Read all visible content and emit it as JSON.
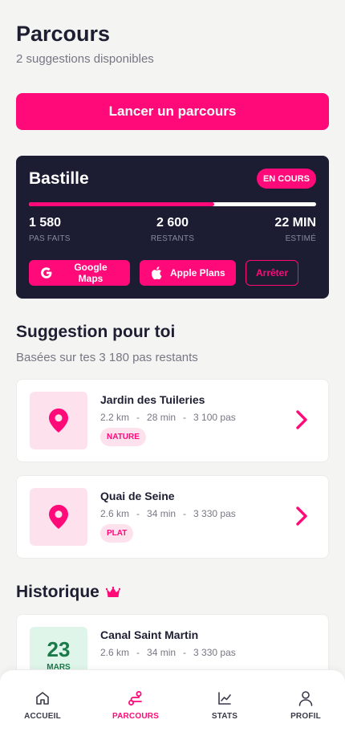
{
  "header": {
    "title": "Parcours",
    "subtitle": "2 suggestions disponibles"
  },
  "launch_button": "Lancer un parcours",
  "active_route": {
    "name": "Bastille",
    "status": "EN COURS",
    "progress_fraction": 0.645,
    "stats": [
      {
        "value": "1 580",
        "label": "PAS FAITS"
      },
      {
        "value": "2 600",
        "label": "RESTANTS"
      },
      {
        "value": "22 MIN",
        "label": "ESTIMÉ"
      }
    ],
    "buttons": {
      "google_maps": "Google Maps",
      "apple_plans": "Apple Plans",
      "stop": "Arrêter"
    }
  },
  "suggestions_section": {
    "title": "Suggestion pour toi",
    "subtitle": "Basées sur tes 3 180 pas restants",
    "items": [
      {
        "name": "Jardin des Tuileries",
        "distance": "2.2 km",
        "duration": "28 min",
        "steps": "3 100 pas",
        "separator": "-",
        "tag": "NATURE"
      },
      {
        "name": "Quai de Seine",
        "distance": "2.6 km",
        "duration": "34 min",
        "steps": "3 330 pas",
        "separator": "-",
        "tag": "PLAT"
      }
    ]
  },
  "history_section": {
    "title": "Historique",
    "icon": "crown-icon",
    "items": [
      {
        "day": "23",
        "month": "MARS",
        "name": "Canal Saint Martin",
        "distance": "2.6 km",
        "duration": "34 min",
        "steps": "3 330 pas",
        "separator": "-"
      }
    ]
  },
  "bottom_nav": [
    {
      "label": "ACCUEIL",
      "icon": "home-icon",
      "active": false
    },
    {
      "label": "PARCOURS",
      "icon": "route-icon",
      "active": true
    },
    {
      "label": "STATS",
      "icon": "chart-icon",
      "active": false
    },
    {
      "label": "PROFIL",
      "icon": "user-icon",
      "active": false
    }
  ],
  "colors": {
    "accent": "#ff0a78",
    "card_dark": "#1c1c33",
    "background": "#f4f4f2",
    "tag_bg": "#fde2ee",
    "date_bg": "#dff5ea",
    "date_text": "#1a7a4a"
  }
}
